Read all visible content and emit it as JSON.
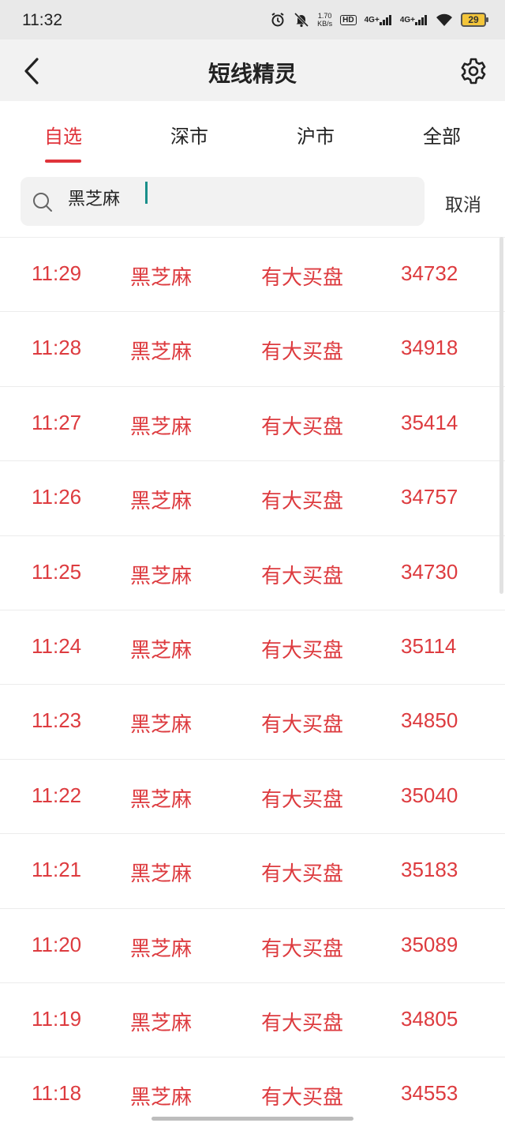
{
  "status_bar": {
    "time": "11:32",
    "net_speed_value": "1.70",
    "net_speed_unit": "KB/s",
    "hd_label": "HD",
    "sim1": "4G+",
    "sim2": "4G+",
    "battery": "29"
  },
  "header": {
    "title": "短线精灵",
    "back_icon": "chevron-left-icon",
    "settings_icon": "gear-icon"
  },
  "tabs": [
    {
      "label": "自选",
      "active": true
    },
    {
      "label": "深市",
      "active": false
    },
    {
      "label": "沪市",
      "active": false
    },
    {
      "label": "全部",
      "active": false
    }
  ],
  "search": {
    "value": "黑芝麻",
    "cancel_label": "取消"
  },
  "rows": [
    {
      "time": "11:29",
      "name": "黑芝麻",
      "desc": "有大买盘",
      "value": "34732"
    },
    {
      "time": "11:28",
      "name": "黑芝麻",
      "desc": "有大买盘",
      "value": "34918"
    },
    {
      "time": "11:27",
      "name": "黑芝麻",
      "desc": "有大买盘",
      "value": "35414"
    },
    {
      "time": "11:26",
      "name": "黑芝麻",
      "desc": "有大买盘",
      "value": "34757"
    },
    {
      "time": "11:25",
      "name": "黑芝麻",
      "desc": "有大买盘",
      "value": "34730"
    },
    {
      "time": "11:24",
      "name": "黑芝麻",
      "desc": "有大买盘",
      "value": "35114"
    },
    {
      "time": "11:23",
      "name": "黑芝麻",
      "desc": "有大买盘",
      "value": "34850"
    },
    {
      "time": "11:22",
      "name": "黑芝麻",
      "desc": "有大买盘",
      "value": "35040"
    },
    {
      "time": "11:21",
      "name": "黑芝麻",
      "desc": "有大买盘",
      "value": "35183"
    },
    {
      "time": "11:20",
      "name": "黑芝麻",
      "desc": "有大买盘",
      "value": "35089"
    },
    {
      "time": "11:19",
      "name": "黑芝麻",
      "desc": "有大买盘",
      "value": "34805"
    },
    {
      "time": "11:18",
      "name": "黑芝麻",
      "desc": "有大买盘",
      "value": "34553"
    }
  ],
  "colors": {
    "accent": "#e0333a",
    "row_text": "#dd3b3f",
    "caret": "#1a8f8a"
  }
}
